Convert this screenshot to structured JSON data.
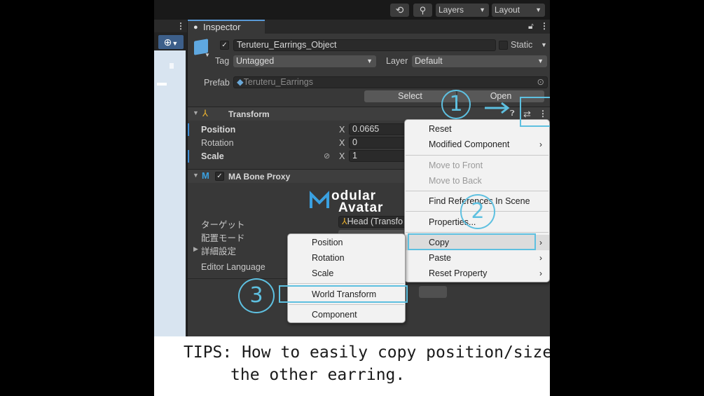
{
  "toolbar": {
    "history_icon": "history-icon",
    "search_icon": "search-icon",
    "layers_label": "Layers",
    "layout_label": "Layout"
  },
  "inspector": {
    "tab_label": "Inspector",
    "object_name": "Teruteru_Earrings_Object",
    "static_label": "Static",
    "tag_label": "Tag",
    "tag_value": "Untagged",
    "layer_label": "Layer",
    "layer_value": "Default",
    "prefab_label": "Prefab",
    "prefab_value": "Teruteru_Earrings",
    "select_label": "Select",
    "open_label": "Open"
  },
  "transform": {
    "title": "Transform",
    "rows": [
      {
        "label": "Position",
        "axis": "X",
        "value": "0.0665"
      },
      {
        "label": "Rotation",
        "axis": "X",
        "value": "0"
      },
      {
        "label": "Scale",
        "axis": "X",
        "value": "1"
      }
    ]
  },
  "bone_proxy": {
    "title": "MA Bone Proxy",
    "logo_line1": "odular",
    "logo_line2": "Avatar",
    "target_label": "ターゲット",
    "target_value": "Head (Transfo",
    "mode_label": "配置モード",
    "advanced_label": "詳細設定",
    "language_label": "Editor Language"
  },
  "context_menu": {
    "items": [
      {
        "label": "Reset",
        "submenu": false,
        "disabled": false
      },
      {
        "label": "Modified Component",
        "submenu": true,
        "disabled": false
      },
      {
        "label": "Move to Front",
        "submenu": false,
        "disabled": true
      },
      {
        "label": "Move to Back",
        "submenu": false,
        "disabled": true
      },
      {
        "label": "Find References In Scene",
        "submenu": false,
        "disabled": false
      },
      {
        "label": "Properties...",
        "submenu": false,
        "disabled": false
      },
      {
        "label": "Copy",
        "submenu": true,
        "disabled": false
      },
      {
        "label": "Paste",
        "submenu": true,
        "disabled": false
      },
      {
        "label": "Reset Property",
        "submenu": true,
        "disabled": false
      }
    ],
    "submenu_glyph": "›"
  },
  "copy_submenu": {
    "items": [
      {
        "label": "Position"
      },
      {
        "label": "Rotation"
      },
      {
        "label": "Scale"
      },
      {
        "label": "World Transform"
      },
      {
        "label": "Component"
      }
    ]
  },
  "annotations": {
    "step1": "1",
    "step2": "2",
    "step3": "3",
    "color": "#5ec0e0"
  },
  "caption": {
    "line1": "TIPS: How to easily copy position/size to",
    "line2": "the other earring."
  },
  "colors": {
    "inspector_bg": "#383838",
    "accent_blue": "#3e8ed6",
    "menu_bg": "#f2f2f2"
  }
}
